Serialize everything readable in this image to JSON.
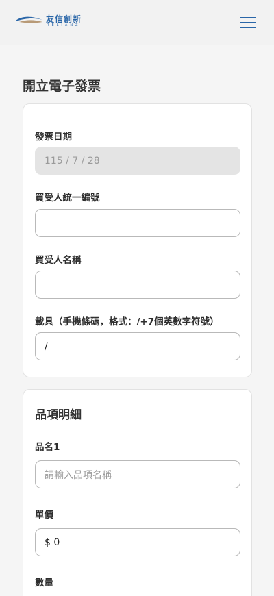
{
  "header": {
    "brand_cn": "友信創新",
    "brand_en": "RELIANZ"
  },
  "page": {
    "title": "開立電子發票"
  },
  "invoice_form": {
    "date_label": "發票日期",
    "date_value": "115 / 7 / 28",
    "buyer_tax_id_label": "買受人統一編號",
    "buyer_tax_id_value": "",
    "buyer_name_label": "買受人名稱",
    "buyer_name_value": "",
    "carrier_label": "載具（手機條碼，格式：/+7個英數字符號）",
    "carrier_value": "/"
  },
  "items": {
    "section_title": "品項明細",
    "item_name_label": "品名1",
    "item_name_placeholder": "請輸入品項名稱",
    "unit_price_label": "單價",
    "unit_price_value": "$ 0",
    "quantity_label": "數量"
  },
  "colors": {
    "brand_blue": "#2a66a8",
    "logo_tan": "#b89a77",
    "background": "#f5f5f5",
    "disabled_field": "#e4e4e4"
  },
  "icons": {
    "menu": "hamburger-icon",
    "logo": "relianz-swoosh-logo"
  }
}
